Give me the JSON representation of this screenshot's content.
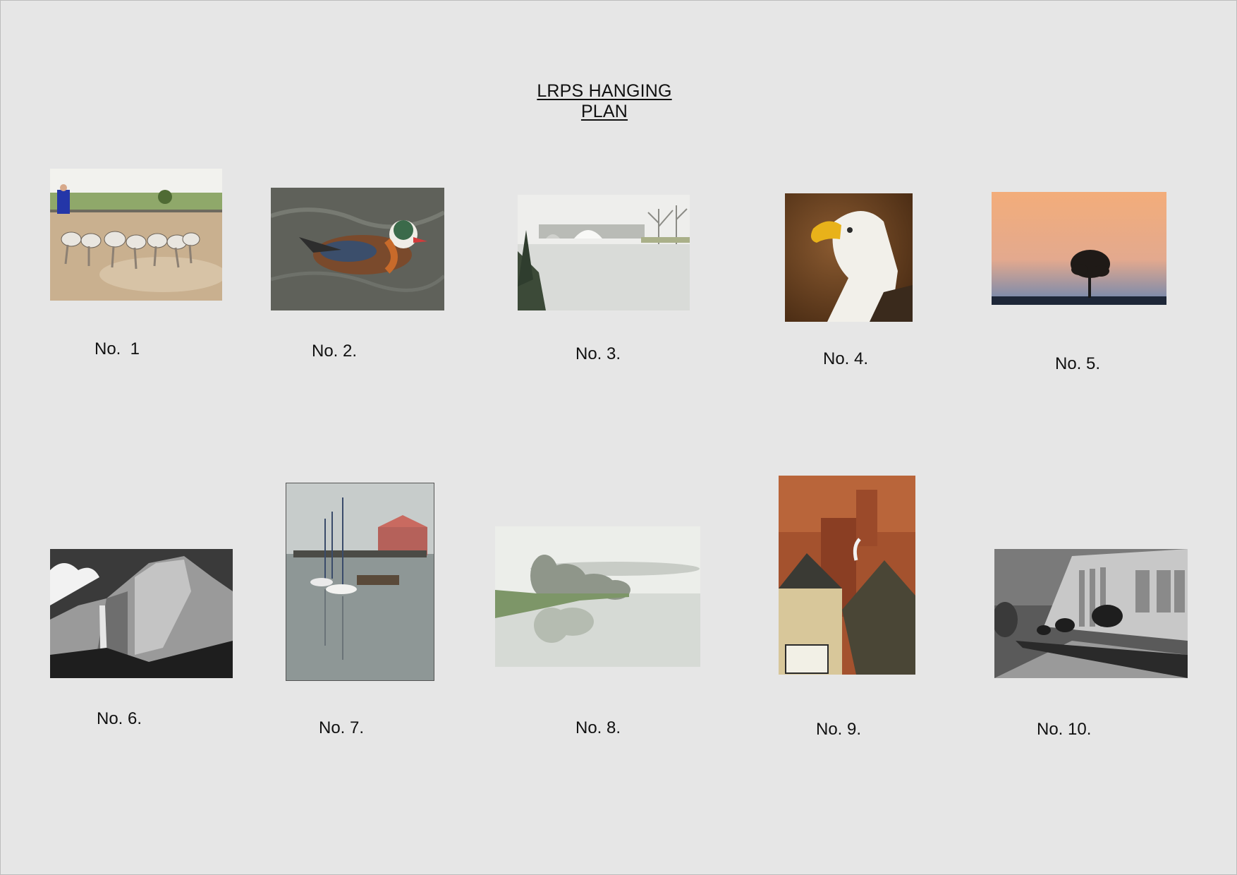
{
  "page": {
    "title": "LRPS HANGING PLAN"
  },
  "photos": [
    {
      "id": 1,
      "caption": "No.  1",
      "icon": "horses-photo"
    },
    {
      "id": 2,
      "caption": "No. 2.",
      "icon": "duck-photo"
    },
    {
      "id": 3,
      "caption": "No. 3.",
      "icon": "bridge-photo"
    },
    {
      "id": 4,
      "caption": "No. 4.",
      "icon": "eagle-photo"
    },
    {
      "id": 5,
      "caption": "No. 5.",
      "icon": "sunset-tree-photo"
    },
    {
      "id": 6,
      "caption": "No. 6.",
      "icon": "mountain-photo"
    },
    {
      "id": 7,
      "caption": "No. 7.",
      "icon": "harbour-photo"
    },
    {
      "id": 8,
      "caption": "No. 8.",
      "icon": "misty-lake-photo"
    },
    {
      "id": 9,
      "caption": "No. 9.",
      "icon": "rooftops-photo"
    },
    {
      "id": 10,
      "caption": "No. 10.",
      "icon": "colonnade-photo"
    }
  ],
  "colors": {
    "background": "#e6e6e6",
    "text": "#111111"
  }
}
